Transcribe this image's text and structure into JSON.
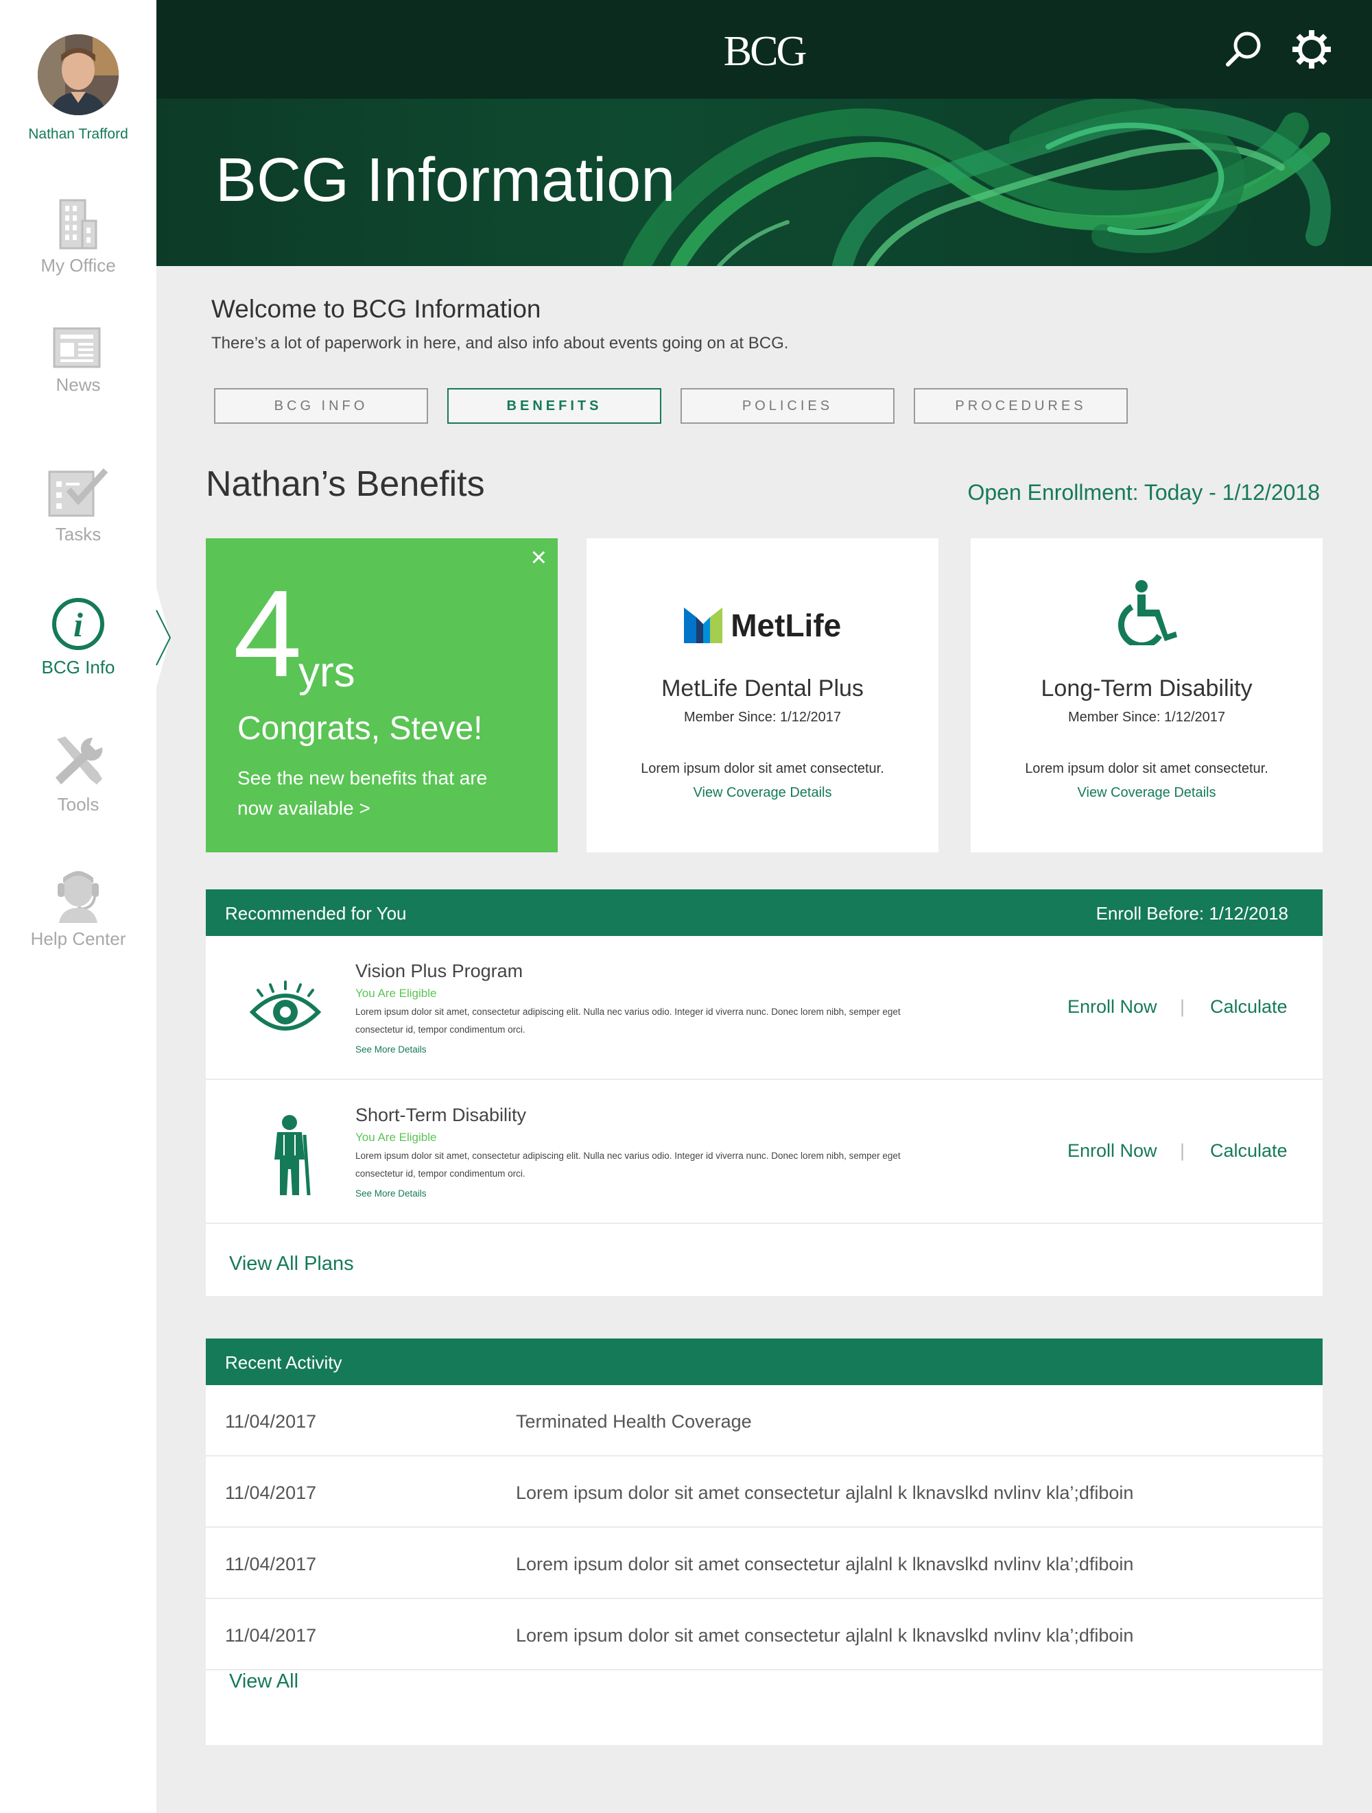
{
  "user": {
    "name": "Nathan Trafford"
  },
  "nav": {
    "items": [
      {
        "label": "My Office",
        "icon": "building-icon"
      },
      {
        "label": "News",
        "icon": "newspaper-icon"
      },
      {
        "label": "Tasks",
        "icon": "tasks-checkbox-icon"
      },
      {
        "label": "BCG Info",
        "icon": "info-icon",
        "active": true
      },
      {
        "label": "Tools",
        "icon": "tools-icon"
      },
      {
        "label": "Help Center",
        "icon": "headset-icon"
      }
    ]
  },
  "header": {
    "logo": "BCG",
    "hero_title": "BCG Information"
  },
  "welcome": {
    "title": "Welcome to BCG Information",
    "subtitle": "There’s a lot of paperwork in here, and also info about events going on at BCG."
  },
  "tabs": [
    {
      "label": "BCG INFO"
    },
    {
      "label": "BENEFITS",
      "active": true
    },
    {
      "label": "POLICIES"
    },
    {
      "label": "PROCEDURES"
    }
  ],
  "benefits": {
    "title": "Nathan’s Benefits",
    "open_enrollment": "Open Enrollment: Today - 1/12/2018",
    "anniversary": {
      "number": "4",
      "unit": "yrs",
      "congrats": "Congrats, Steve!",
      "message": "See the new benefits that are now available >",
      "close": "×"
    },
    "cards": [
      {
        "logo_text": "MetLife",
        "title": "MetLife Dental Plus",
        "member_since": "Member Since: 1/12/2017",
        "desc": "Lorem ipsum dolor sit amet consectetur.",
        "link": "View Coverage Details"
      },
      {
        "title": "Long-Term Disability",
        "member_since": "Member Since: 1/12/2017",
        "desc": "Lorem ipsum dolor sit amet consectetur.",
        "link": "View Coverage Details"
      }
    ]
  },
  "recommended": {
    "title": "Recommended for You",
    "enroll_before": "Enroll Before: 1/12/2018",
    "items": [
      {
        "title": "Vision Plus Program",
        "eligibility": "You Are Eligible",
        "desc": "Lorem ipsum dolor sit amet, consectetur adipiscing elit. Nulla nec varius odio. Integer id viverra nunc. Donec lorem nibh, semper eget consectetur id, tempor condimentum orci.",
        "more": "See More Details",
        "enroll": "Enroll Now",
        "separator": "|",
        "calculate": "Calculate"
      },
      {
        "title": "Short-Term Disability",
        "eligibility": "You Are Eligible",
        "desc": "Lorem ipsum dolor sit amet, consectetur adipiscing elit. Nulla nec varius odio. Integer id viverra nunc. Donec lorem nibh, semper eget consectetur id, tempor condimentum orci.",
        "more": "See More Details",
        "enroll": "Enroll Now",
        "separator": "|",
        "calculate": "Calculate"
      }
    ],
    "view_all": "View All Plans"
  },
  "activity": {
    "title": "Recent Activity",
    "rows": [
      {
        "date": "11/04/2017",
        "text": "Terminated Health Coverage"
      },
      {
        "date": "11/04/2017",
        "text": "Lorem ipsum dolor sit amet consectetur ajlalnl k lknavslkd nvlinv kla’;dfiboin"
      },
      {
        "date": "11/04/2017",
        "text": "Lorem ipsum dolor sit amet consectetur ajlalnl k lknavslkd nvlinv kla’;dfiboin"
      },
      {
        "date": "11/04/2017",
        "text": "Lorem ipsum dolor sit amet consectetur ajlalnl k lknavslkd nvlinv kla’;dfiboin"
      }
    ],
    "view_all": "View All"
  },
  "colors": {
    "brand_green": "#157a57",
    "accent_green": "#5ac455",
    "header_dark": "#0b2b1f"
  }
}
